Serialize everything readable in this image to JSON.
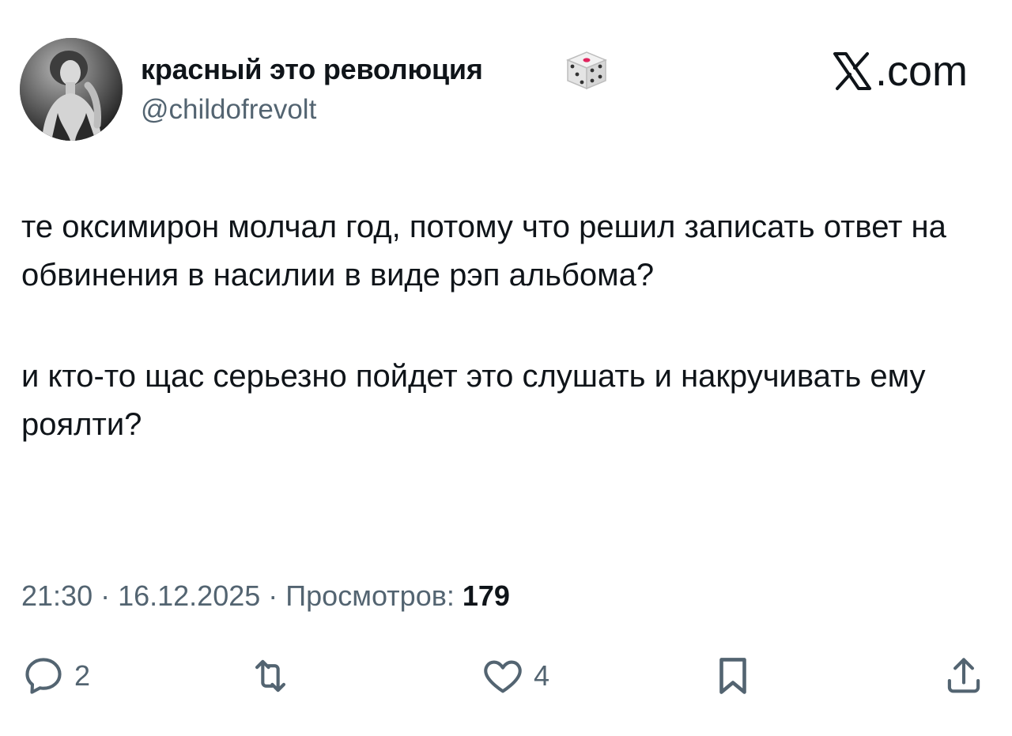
{
  "author": {
    "display_name": "красный это революция",
    "handle": "@childofrevolt",
    "avatar_icon": "avatar-photo",
    "badge_icon": "dice-icon"
  },
  "brand": {
    "icon": "x-logo-icon",
    "label": ".com"
  },
  "tweet": {
    "paragraph_1": "те оксимирон молчал год, потому что решил записать ответ на обвинения в насилии в виде рэп альбома?",
    "paragraph_2": "и кто-то щас серьезно пойдет это слушать и накручивать ему роялти?"
  },
  "meta": {
    "time": "21:30",
    "separator": " · ",
    "date": "16.12.2025",
    "views_label": "Просмотров:",
    "views_count": "179"
  },
  "actions": {
    "reply_count": "2",
    "retweet_count": "",
    "like_count": "4"
  },
  "colors": {
    "text_primary": "#0f1419",
    "text_secondary": "#536471",
    "background": "#ffffff"
  }
}
